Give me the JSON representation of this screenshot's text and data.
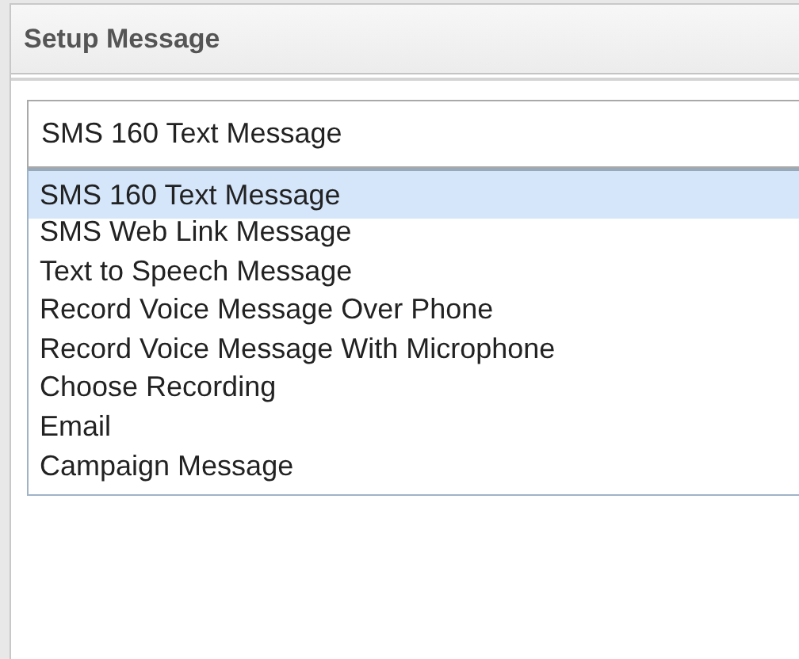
{
  "panel": {
    "title": "Setup Message"
  },
  "select": {
    "value": "SMS 160 Text Message"
  },
  "options": [
    {
      "label": "SMS 160 Text Message",
      "selected": true
    },
    {
      "label": "SMS Web Link Message",
      "selected": false
    },
    {
      "label": "Text to Speech Message",
      "selected": false
    },
    {
      "label": "Record Voice Message Over Phone",
      "selected": false
    },
    {
      "label": "Record Voice Message With Microphone",
      "selected": false
    },
    {
      "label": "Choose Recording",
      "selected": false
    },
    {
      "label": "Email",
      "selected": false
    },
    {
      "label": "Campaign Message",
      "selected": false
    }
  ]
}
